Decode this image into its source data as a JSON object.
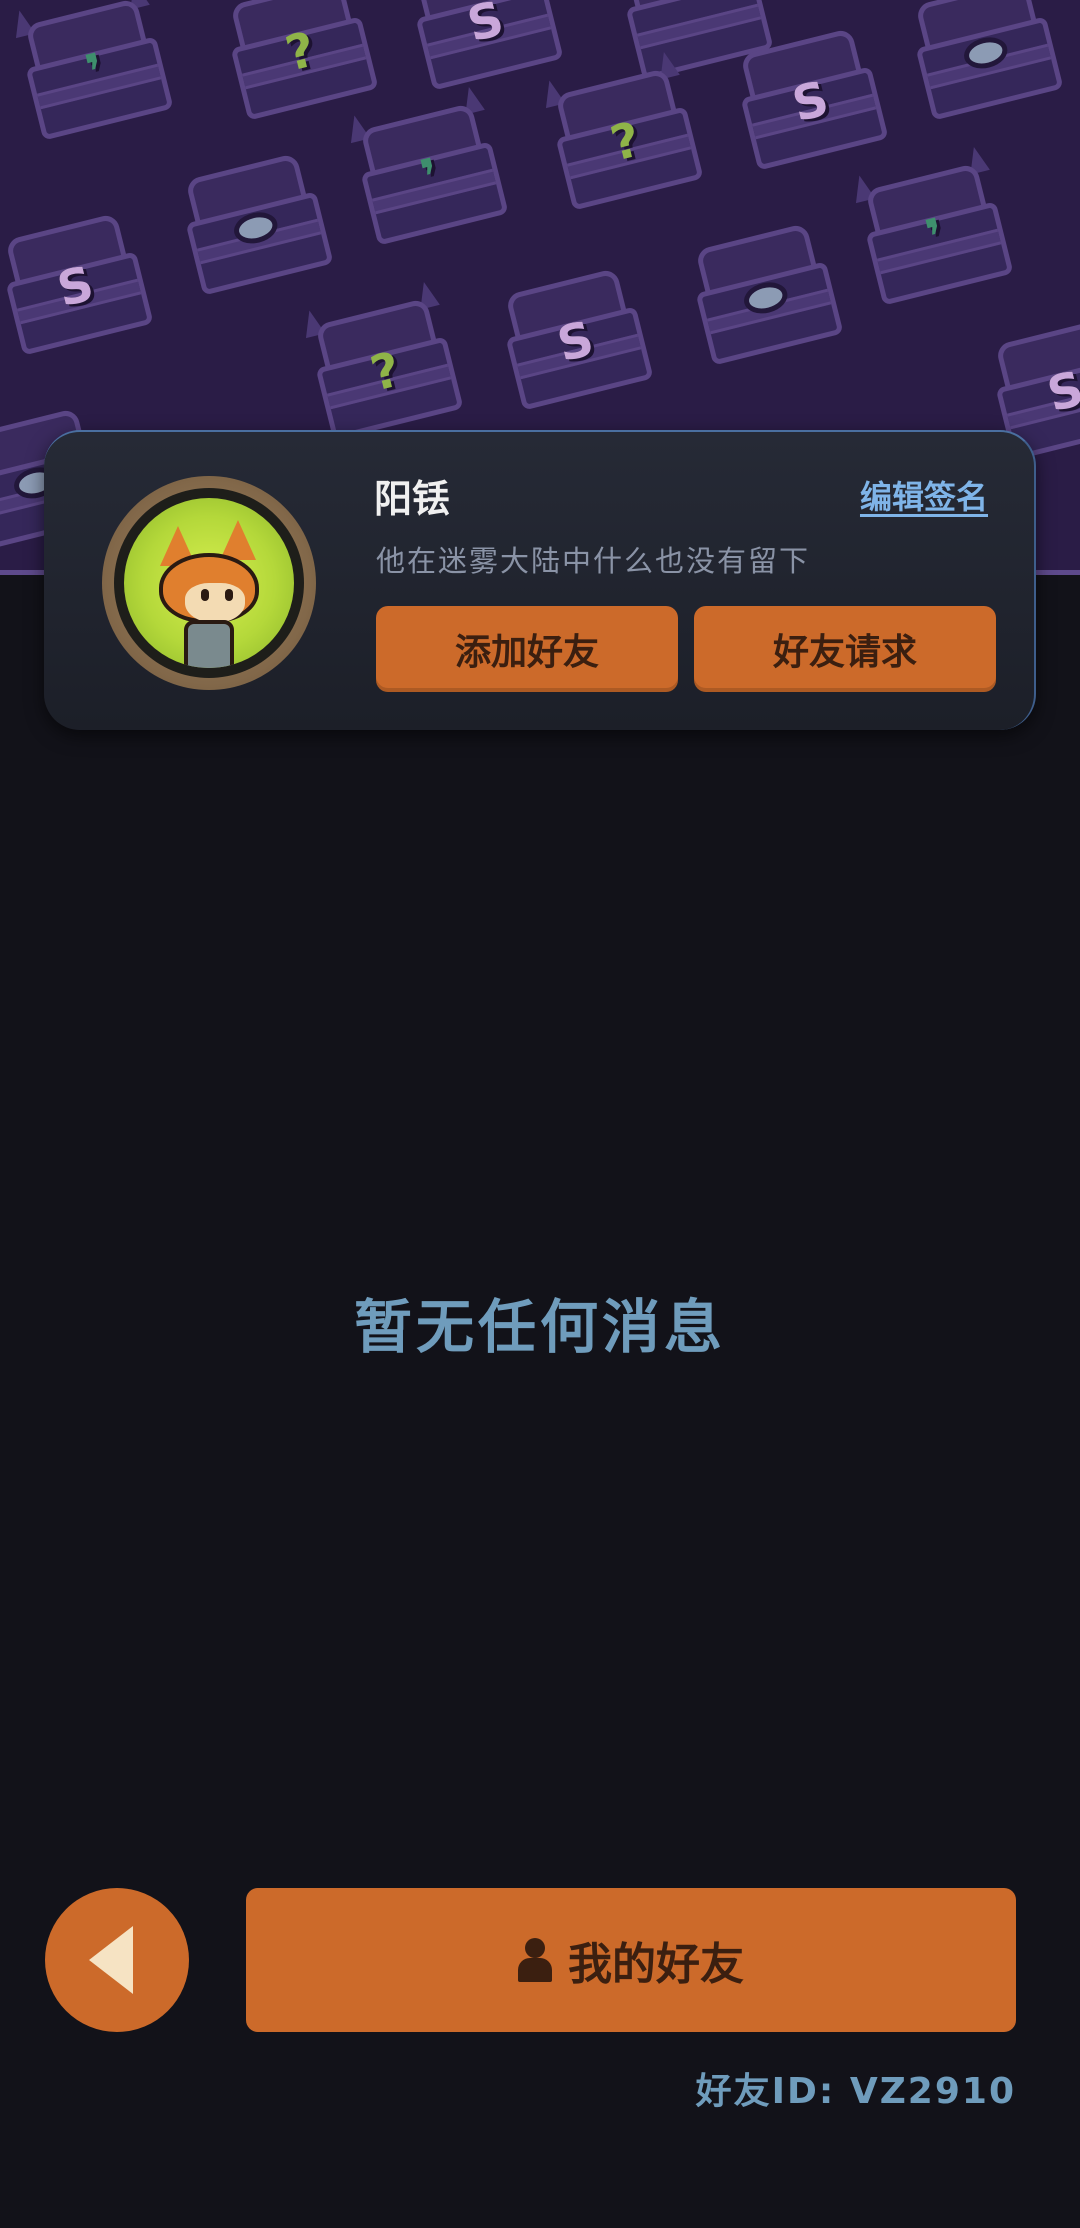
{
  "profile": {
    "name": "阳铥",
    "edit_signature_label": "编辑签名",
    "signature": "他在迷雾大陆中什么也没有留下",
    "add_friend_label": "添加好友",
    "friend_request_label": "好友请求"
  },
  "messages": {
    "empty_text": "暂无任何消息"
  },
  "footer": {
    "my_friends_label": "我的好友",
    "friend_id_text": "好友ID: VZ2910"
  },
  "icons": {
    "back": "back-arrow-icon",
    "person": "person-icon"
  },
  "colors": {
    "background": "#121219",
    "banner": "#2a1c46",
    "accent_orange": "#cc6a2a",
    "link_blue": "#7fb4e8",
    "muted_blue": "#6f9cbc"
  }
}
